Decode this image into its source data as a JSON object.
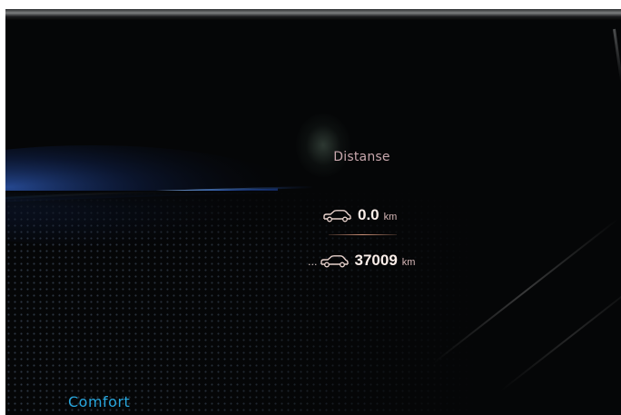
{
  "trip_computer": {
    "title": "Distanse",
    "trip": {
      "icon": "car-icon",
      "value": "0.0",
      "unit": "km"
    },
    "total": {
      "icon": "car-icon",
      "prefix": "...",
      "value": "37009",
      "unit": "km"
    }
  },
  "drive_mode": {
    "label": "Comfort",
    "color": "#28a6dd"
  },
  "colors": {
    "screen_background": "#050607",
    "title_text": "#c8a7ad",
    "value_text": "#fbeee9",
    "accent_glow": "#2a8cff"
  }
}
